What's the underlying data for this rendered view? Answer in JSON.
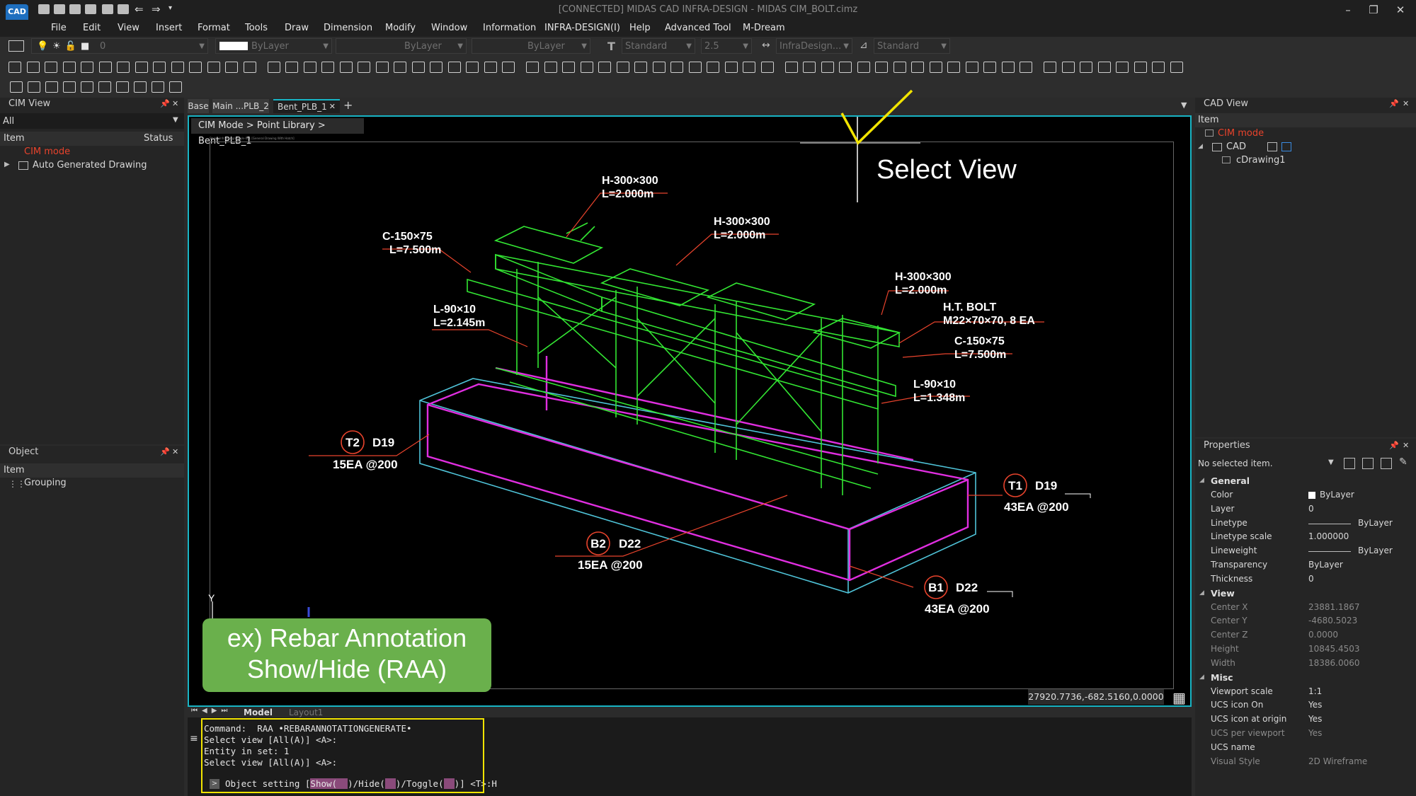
{
  "window": {
    "title": "[CONNECTED] MIDAS CAD INFRA-DESIGN - MIDAS CIM_BOLT.cimz",
    "logo": "CAD"
  },
  "menu": [
    "File",
    "Edit",
    "View",
    "Insert",
    "Format",
    "Tools",
    "Draw",
    "Dimension",
    "Modify",
    "Window",
    "Information",
    "INFRA-DESIGN(I)",
    "Help",
    "Advanced Tool",
    "M-Dream"
  ],
  "propbar": {
    "layer": "0",
    "color": "ByLayer",
    "linetype": "ByLayer",
    "lineweight": "ByLayer",
    "text_style": "Standard",
    "text_height": "2.5",
    "dim_style": "InfraDesign...",
    "table_style": "Standard"
  },
  "cim_view": {
    "title": "CIM View",
    "filter": "All",
    "columns": [
      "Item",
      "Status"
    ],
    "items": [
      {
        "label": "CIM mode",
        "accent": true
      },
      {
        "label": "Auto Generated Drawing",
        "accent": false
      }
    ]
  },
  "object_panel": {
    "title": "Object",
    "column": "Item",
    "items": [
      "Grouping"
    ]
  },
  "doc_tabs": [
    "Base",
    "Main ...PLB_2",
    "Bent_PLB_1"
  ],
  "active_tab": "Bent_PLB_1",
  "breadcrumb": "CIM Mode > Point Library > Bent_PLB_1",
  "drawing": {
    "frame_caption": "Style : InfraDesign_Style-001 [General Drawing With Hatch]",
    "select_view": "Select View",
    "callout": "ex) Rebar Annotation\nShow/Hide (RAA)",
    "labels": [
      {
        "l1": "H-300×300",
        "l2": "L=2.000m"
      },
      {
        "l1": "H-300×300",
        "l2": "L=2.000m"
      },
      {
        "l1": "C-150×75",
        "l2": "L=7.500m"
      },
      {
        "l1": "H-300×300",
        "l2": "L=2.000m"
      },
      {
        "l1": "L-90×10",
        "l2": "L=2.145m"
      },
      {
        "l1": "H.T. BOLT",
        "l2": "M22×70×70, 8 EA"
      },
      {
        "l1": "C-150×75",
        "l2": "L=7.500m"
      },
      {
        "l1": "L-90×10",
        "l2": "L=1.348m"
      }
    ],
    "rebars": [
      {
        "tag": "T2",
        "dia": "D19",
        "spec": "15EA @200"
      },
      {
        "tag": "T1",
        "dia": "D19",
        "spec": "43EA @200"
      },
      {
        "tag": "B2",
        "dia": "D22",
        "spec": "15EA @200"
      },
      {
        "tag": "B1",
        "dia": "D22",
        "spec": "43EA @200"
      }
    ],
    "coords": "27920.7736,-682.5160,0.0000",
    "ucs_y": "Y"
  },
  "layout_tabs": [
    "Model",
    "Layout1"
  ],
  "command": {
    "lines": [
      "Command:  RAA •REBARANNOTATIONGENERATE•",
      "Select view [All(A)] <A>:",
      "Entity in set: 1",
      "Select view [All(A)] <A>:"
    ],
    "prompt_prefix": "Object setting [",
    "options": [
      "Show(",
      ")/Hide(",
      ")/Toggle(",
      ")] <T>:H"
    ]
  },
  "cad_view": {
    "title": "CAD View",
    "column": "Item",
    "items": [
      {
        "label": "CIM mode",
        "accent": true
      },
      {
        "label": "CAD",
        "accent": false
      },
      {
        "label": "cDrawing1",
        "accent": false
      }
    ]
  },
  "properties": {
    "title": "Properties",
    "selection": "No selected item.",
    "groups": [
      {
        "name": "General",
        "rows": [
          {
            "k": "Color",
            "v": "ByLayer",
            "swatch": "#ffffff"
          },
          {
            "k": "Layer",
            "v": "0"
          },
          {
            "k": "Linetype",
            "v": "ByLayer",
            "line": true
          },
          {
            "k": "Linetype scale",
            "v": "1.000000"
          },
          {
            "k": "Lineweight",
            "v": "ByLayer",
            "line": true
          },
          {
            "k": "Transparency",
            "v": "ByLayer"
          },
          {
            "k": "Thickness",
            "v": "0"
          }
        ]
      },
      {
        "name": "View",
        "rows": [
          {
            "k": "Center X",
            "v": "23881.1867",
            "dim": true
          },
          {
            "k": "Center Y",
            "v": "-4680.5023",
            "dim": true
          },
          {
            "k": "Center Z",
            "v": "0.0000",
            "dim": true
          },
          {
            "k": "Height",
            "v": "10845.4503",
            "dim": true
          },
          {
            "k": "Width",
            "v": "18386.0060",
            "dim": true
          }
        ]
      },
      {
        "name": "Misc",
        "rows": [
          {
            "k": "Viewport scale",
            "v": "1:1"
          },
          {
            "k": "UCS icon On",
            "v": "Yes"
          },
          {
            "k": "UCS icon at origin",
            "v": "Yes"
          },
          {
            "k": "UCS per viewport",
            "v": "Yes",
            "dim": true
          },
          {
            "k": "UCS name",
            "v": ""
          },
          {
            "k": "Visual Style",
            "v": "2D Wireframe",
            "dim": true
          }
        ]
      }
    ]
  },
  "colors": {
    "viewport_border": "#18b4c4",
    "accent_red": "#e8432c",
    "steel_green": "#33e633",
    "rebar_magenta": "#e02ee0",
    "concrete_cyan": "#4fc3d8",
    "callout_green": "#6ab04c",
    "highlight_yellow": "#f2e400"
  }
}
